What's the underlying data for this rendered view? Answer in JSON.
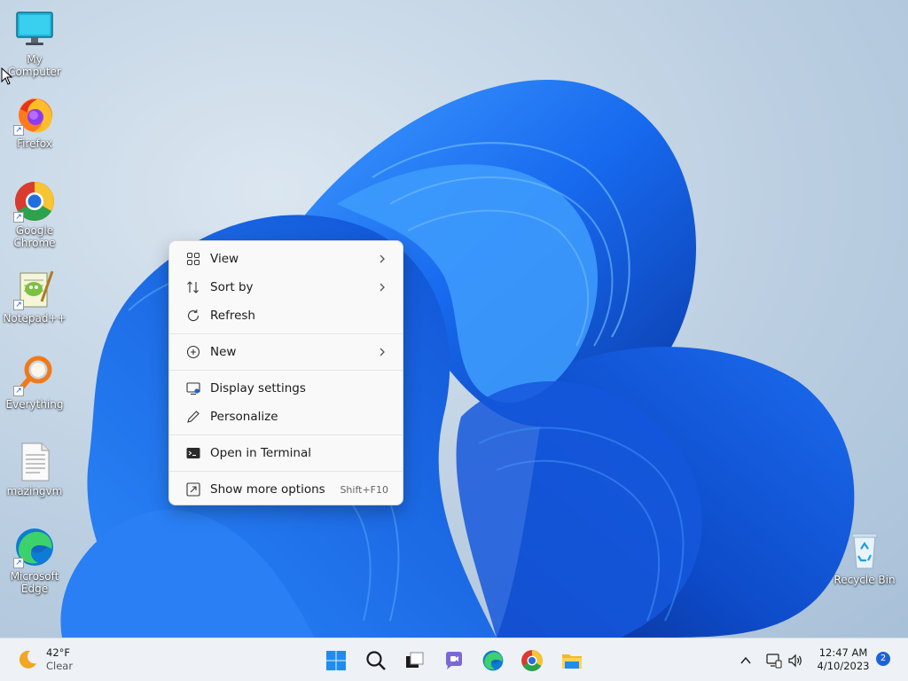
{
  "desktop": {
    "icons": [
      {
        "label": "My Computer",
        "icon": "monitor-icon"
      },
      {
        "label": "Firefox",
        "icon": "firefox-icon"
      },
      {
        "label": "Google Chrome",
        "icon": "chrome-icon"
      },
      {
        "label": "Notepad++",
        "icon": "notepadpp-icon"
      },
      {
        "label": "Everything",
        "icon": "everything-search-icon"
      },
      {
        "label": "mazingvm",
        "icon": "text-file-icon"
      },
      {
        "label": "Microsoft Edge",
        "icon": "edge-icon"
      },
      {
        "label": "Recycle Bin",
        "icon": "recycle-bin-icon"
      }
    ]
  },
  "context_menu": {
    "items": [
      {
        "label": "View",
        "icon": "grid-view-icon",
        "submenu": true
      },
      {
        "label": "Sort by",
        "icon": "sort-icon",
        "submenu": true
      },
      {
        "label": "Refresh",
        "icon": "refresh-icon",
        "submenu": false
      },
      {
        "label": "New",
        "icon": "add-circle-icon",
        "submenu": true
      },
      {
        "label": "Display settings",
        "icon": "display-settings-icon",
        "submenu": false
      },
      {
        "label": "Personalize",
        "icon": "pen-icon",
        "submenu": false
      },
      {
        "label": "Open in Terminal",
        "icon": "terminal-icon",
        "submenu": false
      },
      {
        "label": "Show more options",
        "icon": "more-options-icon",
        "shortcut": "Shift+F10"
      }
    ]
  },
  "taskbar": {
    "weather": {
      "temp": "42°F",
      "condition": "Clear",
      "icon": "moon-icon"
    },
    "apps": [
      "start-icon",
      "search-icon",
      "task-view-icon",
      "teams-chat-icon",
      "edge-icon",
      "chrome-icon",
      "file-explorer-icon"
    ],
    "tray": {
      "chevron": "show-hidden-icons",
      "network": "network-icon",
      "volume": "speaker-icon"
    },
    "clock": {
      "time": "12:47 AM",
      "date": "4/10/2023"
    },
    "notifications": "2"
  },
  "colors": {
    "accent": "#1e63d6",
    "bloom_light": "#2f8cf5",
    "bloom_dark": "#0a3fb8"
  }
}
